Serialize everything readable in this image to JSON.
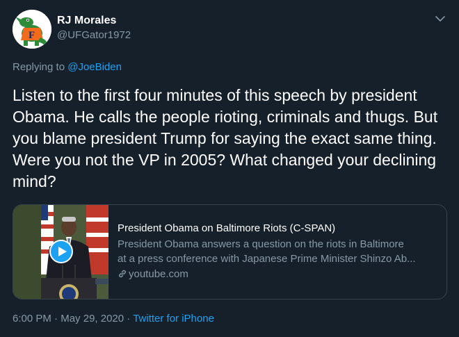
{
  "author": {
    "display_name": "RJ Morales",
    "handle": "@UFGator1972",
    "avatar_icon": "gator-logo-avatar"
  },
  "reply": {
    "prefix": "Replying to ",
    "mention": "@JoeBiden"
  },
  "tweet": {
    "text": "Listen to the first four minutes of this speech by president Obama. He calls the people rioting, criminals and thugs. But you blame president Trump for saying the exact same thing. Were you not the VP in 2005? What changed your declining mind?"
  },
  "card": {
    "title": "President Obama on Baltimore Riots (C-SPAN)",
    "description_line1": "President Obama answers a question on the riots in Baltimore",
    "description_line2": "at a press conference with Japanese Prime Minister Shinzo Ab...",
    "domain": "youtube.com",
    "thumbnail_icon": "video-thumbnail",
    "play_icon": "play-icon",
    "link_icon": "link-icon"
  },
  "meta": {
    "time": "6:00 PM",
    "separator1": " · ",
    "date": "May 29, 2020",
    "separator2": " · ",
    "source": "Twitter for iPhone"
  },
  "colors": {
    "background": "#15202b",
    "accent": "#1da1f2",
    "secondary_text": "#8899a6",
    "border": "#38444d"
  },
  "menu": {
    "icon": "chevron-down-icon"
  }
}
